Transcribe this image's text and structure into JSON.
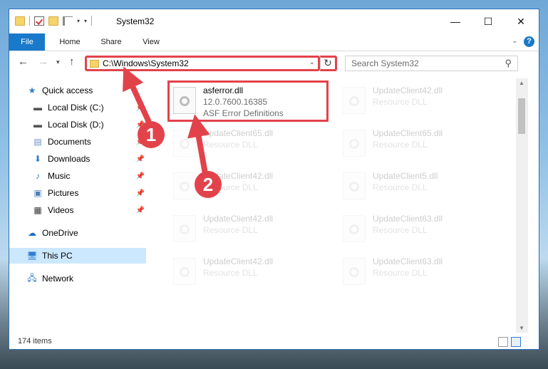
{
  "window": {
    "title": "System32"
  },
  "ribbon": {
    "tabs": [
      "File",
      "Home",
      "Share",
      "View"
    ],
    "help": "?"
  },
  "address": {
    "path": "C:\\Windows\\System32"
  },
  "search": {
    "placeholder": "Search System32"
  },
  "sidebar": {
    "items": [
      {
        "label": "Quick access",
        "icon": "star-icon"
      },
      {
        "label": "Local Disk (C:)",
        "icon": "drive-icon"
      },
      {
        "label": "Local Disk (D:)",
        "icon": "drive-icon"
      },
      {
        "label": "Documents",
        "icon": "documents-icon"
      },
      {
        "label": "Downloads",
        "icon": "download-icon"
      },
      {
        "label": "Music",
        "icon": "music-icon"
      },
      {
        "label": "Pictures",
        "icon": "pictures-icon"
      },
      {
        "label": "Videos",
        "icon": "videos-icon"
      },
      {
        "label": "OneDrive",
        "icon": "cloud-icon"
      },
      {
        "label": "This PC",
        "icon": "computer-icon"
      },
      {
        "label": "Network",
        "icon": "network-icon"
      }
    ]
  },
  "files": [
    {
      "name": "asferror.dll",
      "version": "12.0.7600.16385",
      "desc": "ASF Error Definitions"
    },
    {
      "name": "UpdateClient42.dll",
      "desc": "Resource DLL"
    },
    {
      "name": "UpdateClient65.dll",
      "desc": "Resource DLL"
    },
    {
      "name": "UpdateClient65.dll",
      "desc": "Resource DLL"
    },
    {
      "name": "UpdateClient42.dll",
      "desc": "Resource DLL"
    },
    {
      "name": "UpdateClient5.dll",
      "desc": "Resource DLL"
    },
    {
      "name": "UpdateClient42.dll",
      "desc": "Resource DLL"
    },
    {
      "name": "UpdateClient63.dll",
      "desc": "Resource DLL"
    },
    {
      "name": "UpdateClient42.dll",
      "desc": "Resource DLL"
    },
    {
      "name": "UpdateClient63.dll",
      "desc": "Resource DLL"
    }
  ],
  "status": {
    "count": "174 items"
  },
  "annotations": {
    "step1": "1",
    "step2": "2"
  },
  "colors": {
    "accent": "#1979ca",
    "highlight": "#e2434b",
    "selected": "#cce8ff"
  }
}
